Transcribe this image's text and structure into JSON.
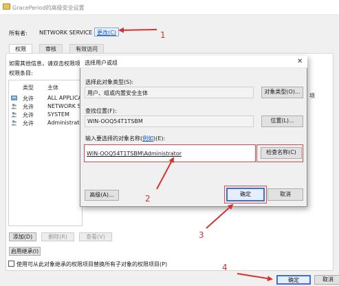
{
  "window": {
    "title": "GracePeriod的高级安全设置"
  },
  "owner": {
    "label": "所有者:",
    "value": "NETWORK SERVICE",
    "change_link": "更改(C)"
  },
  "tabs": [
    {
      "label": "权限",
      "active": true
    },
    {
      "label": "审核",
      "active": false
    },
    {
      "label": "有效访问",
      "active": false
    }
  ],
  "permissions": {
    "hint": "如需其他信息，请双击权限项",
    "entries_label": "权限条目:",
    "columns": [
      "类型",
      "主体"
    ],
    "rows": [
      {
        "type": "允许",
        "principal": "ALL APPLICAT",
        "icon": "group-icon"
      },
      {
        "type": "允许",
        "principal": "NETWORK SE",
        "icon": "user-icon"
      },
      {
        "type": "允许",
        "principal": "SYSTEM",
        "icon": "user-icon"
      },
      {
        "type": "允许",
        "principal": "Administrator",
        "icon": "user-icon"
      }
    ],
    "right_partial": "项"
  },
  "buttons": {
    "add": "添加(D)",
    "remove": "删除(R)",
    "view": "查看(V)",
    "enable_inheritance": "启用继承(I)",
    "ok": "确定",
    "cancel": "取消"
  },
  "replace_checkbox": {
    "label": "使用可从此对象继承的权限项目替换所有子对象的权限项目(P)",
    "checked": false
  },
  "dialog": {
    "title": "选择用户或组",
    "object_type_label": "选择此对象类型(S):",
    "object_type_value": "用户、组或内置安全主体",
    "object_type_button": "对象类型(O)...",
    "location_label": "查找位置(F):",
    "location_value": "WIN-OOQ54T1TSBM",
    "location_button": "位置(L)...",
    "names_label_prefix": "输入要选择的对象名称(",
    "names_label_link": "例如",
    "names_label_suffix": ")(E):",
    "names_value": "WIN-OOQ54T1TSBM\\Administrator",
    "check_names_button": "检查名称(C)",
    "advanced_button": "高级(A)...",
    "ok_button": "确定",
    "cancel_button": "取消",
    "close_glyph": "✕"
  },
  "annotations": {
    "step_numbers": [
      "1",
      "2",
      "3",
      "4"
    ],
    "color": "#d9302f"
  }
}
